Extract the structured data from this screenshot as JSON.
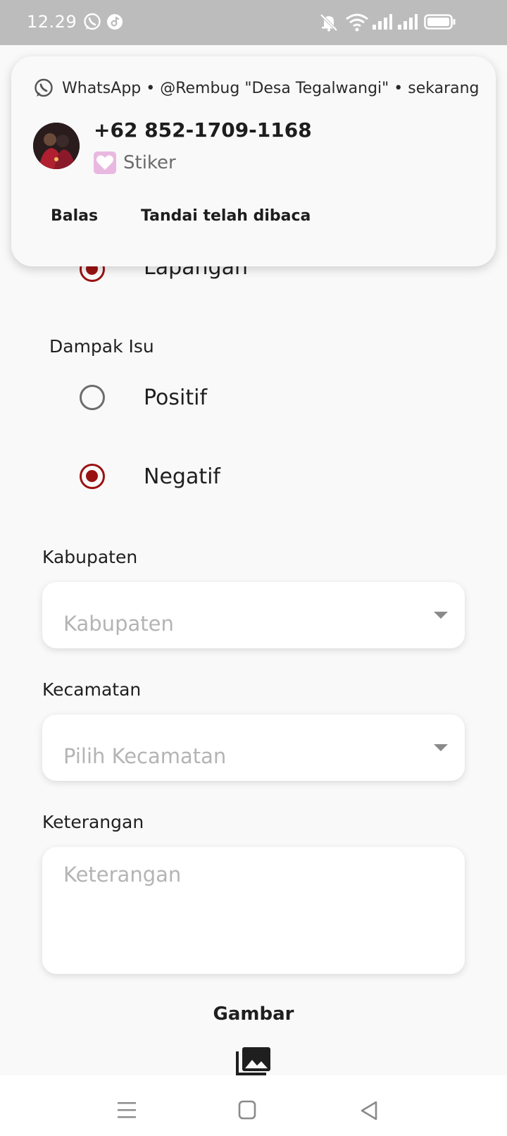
{
  "status_bar": {
    "time": "12.29",
    "left_icons": [
      "whatsapp-icon",
      "tiktok-icon"
    ],
    "right_icons": [
      "mute-icon",
      "wifi-icon",
      "signal-icon",
      "signal-icon",
      "battery-icon"
    ]
  },
  "notification": {
    "header": "WhatsApp • @Rembug \"Desa Tegalwangi\" • sekarang",
    "sender": "+62 852-1709-1168",
    "message": "Stiker",
    "actions": {
      "reply": "Balas",
      "mark_read": "Tandai telah dibaca"
    }
  },
  "form": {
    "lokasi_option": "Lapangan",
    "dampak_isu": {
      "label": "Dampak Isu",
      "options": [
        {
          "label": "Positif",
          "selected": false
        },
        {
          "label": "Negatif",
          "selected": true
        }
      ]
    },
    "kabupaten": {
      "label": "Kabupaten",
      "placeholder": "Kabupaten"
    },
    "kecamatan": {
      "label": "Kecamatan",
      "placeholder": "Pilih Kecamatan"
    },
    "keterangan": {
      "label": "Keterangan",
      "placeholder": "Keterangan"
    },
    "gambar": {
      "label": "Gambar"
    }
  },
  "colors": {
    "accent": "#9b1111",
    "status_bar": "#bcbcbc",
    "background": "#f9f9f9"
  }
}
